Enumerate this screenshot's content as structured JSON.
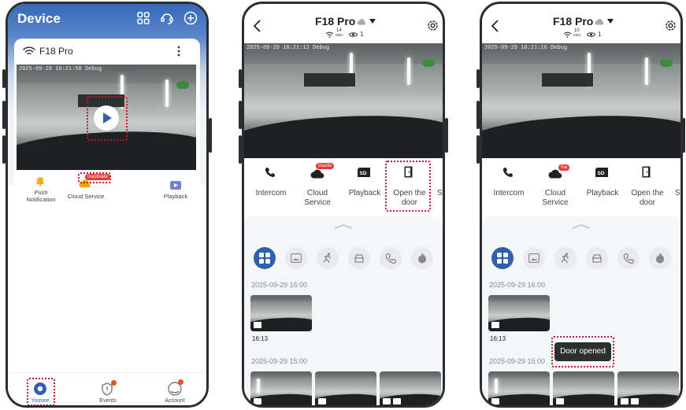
{
  "screen1": {
    "header_title": "Device",
    "device_name": "F18 Pro",
    "preview_timestamp": "2025-09-29 16:21:58 Debug",
    "actions": [
      {
        "label": "Push Notification",
        "icon": "bell-icon"
      },
      {
        "label": "Cloud Service",
        "badge": "Inactivate",
        "icon": "cloud-icon"
      },
      {
        "label": "Playback",
        "icon": "playback-icon"
      }
    ],
    "tabs": [
      {
        "label": "Yoosee",
        "icon": "home-camera-icon"
      },
      {
        "label": "Events",
        "icon": "events-icon"
      },
      {
        "label": "Account",
        "icon": "account-icon"
      }
    ]
  },
  "screen2": {
    "title": "F18 Pro",
    "speed_value": "14",
    "speed_unit": "KB/s",
    "viewers": "1",
    "live_timestamp": "2025-09-29 16:21:12 Debug",
    "actions": [
      {
        "label": "Intercom",
        "icon": "phone-icon"
      },
      {
        "label": "Cloud Service",
        "badge": "Inactiv",
        "icon": "cloud-icon"
      },
      {
        "label": "Playback",
        "icon": "sd-icon"
      },
      {
        "label": "Open the door",
        "icon": "door-icon"
      },
      {
        "label": "Sp",
        "icon": ""
      }
    ],
    "date1": "2025-09-29 16:00",
    "event_time": "16:13",
    "date2": "2025-09-29 15:00"
  },
  "screen3": {
    "title": "F18 Pro",
    "speed_value": "10",
    "speed_unit": "KB/s",
    "viewers": "1",
    "live_timestamp": "2025-09-29 16:21:16 Debug",
    "actions": [
      {
        "label": "Intercom",
        "icon": "phone-icon"
      },
      {
        "label": "Cloud Service",
        "badge": "Ina",
        "icon": "cloud-icon"
      },
      {
        "label": "Playback",
        "icon": "sd-icon"
      },
      {
        "label": "Open the door",
        "icon": "door-icon"
      },
      {
        "label": "Sp",
        "icon": ""
      }
    ],
    "date1": "2025-09-29 16:00",
    "event_time": "16:13",
    "date2": "2025-09-29 15:00",
    "toast": "Door opened"
  },
  "colors": {
    "accent": "#2f5fb0",
    "highlight": "#c0192b",
    "badge": "#e53935"
  }
}
